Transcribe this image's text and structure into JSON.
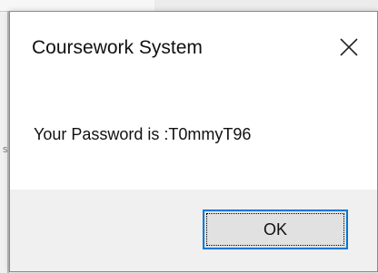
{
  "dialog": {
    "title": "Coursework System",
    "message": "Your Password is :T0mmyT96",
    "ok_label": "OK",
    "close_icon": "close-icon"
  },
  "colors": {
    "dialog_bg": "#ffffff",
    "footer_bg": "#f0f0f0",
    "button_bg": "#e1e1e1",
    "focus_border": "#0078d7",
    "text": "#111111"
  },
  "background": {
    "partial_glyph": "s"
  }
}
